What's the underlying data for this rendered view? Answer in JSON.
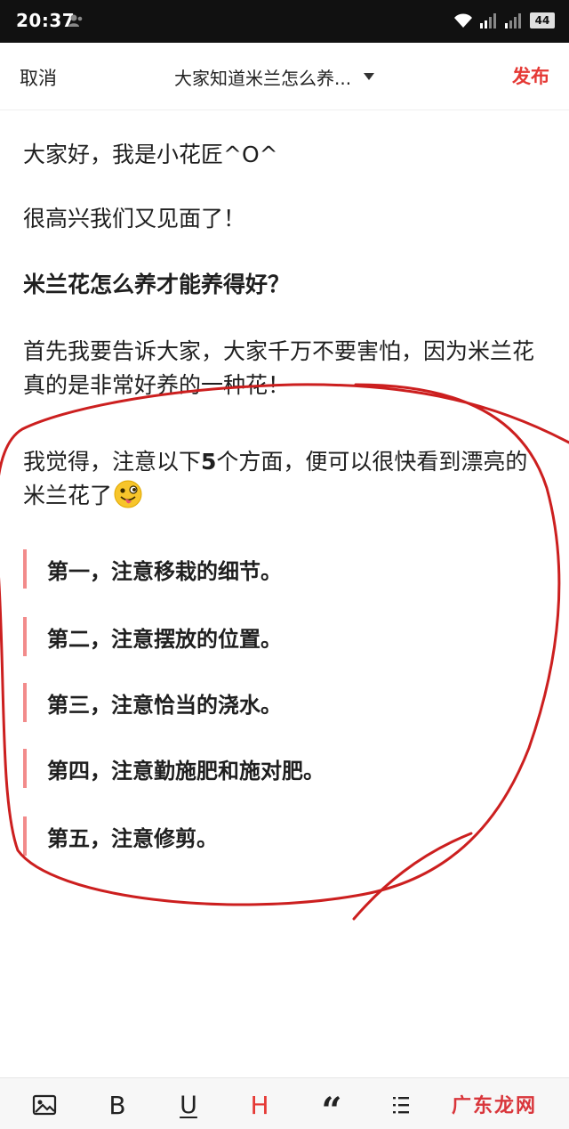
{
  "status_bar": {
    "time": "20:37",
    "battery": "44"
  },
  "header": {
    "cancel_label": "取消",
    "title": "大家知道米兰怎么养...",
    "publish_label": "发布"
  },
  "content": {
    "p1": "大家好，我是小花匠^O^",
    "p2": "很高兴我们又见面了！",
    "p3": "米兰花怎么养才能养得好？",
    "p4": "首先我要告诉大家，大家千万不要害怕，因为米兰花真的是非常好养的一种花！",
    "p5_before": "我觉得，注意以下",
    "p5_number": "5",
    "p5_after": "个方面，便可以很快看到漂亮的米兰花了",
    "quotes": [
      "第一，注意移栽的细节。",
      "第二，注意摆放的位置。",
      "第三，注意恰当的浇水。",
      "第四，注意勤施肥和施对肥。",
      "第五，注意修剪。"
    ]
  },
  "toolbar": {
    "bold_label": "B",
    "underline_label": "U",
    "heading_label": "H",
    "quote_label": "“",
    "active_color": "#e53935"
  },
  "watermark": "广东龙网",
  "colors": {
    "accent": "#e53935",
    "quote_bar": "#f28b8b",
    "annotation": "#cc1f1f"
  }
}
